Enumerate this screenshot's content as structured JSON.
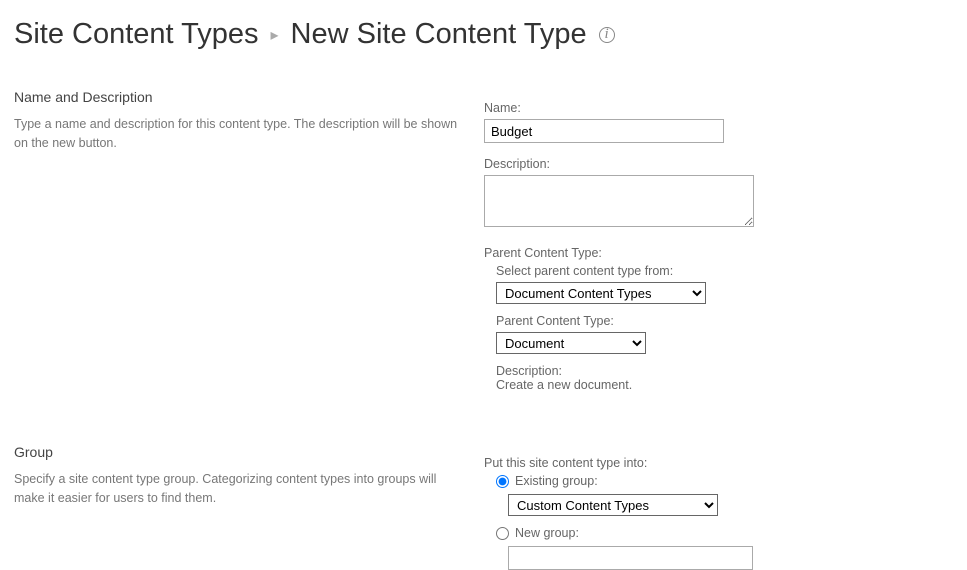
{
  "header": {
    "breadcrumb_link": "Site Content Types",
    "title": "New Site Content Type",
    "info_glyph": "i"
  },
  "section_name": {
    "heading": "Name and Description",
    "helptext": "Type a name and description for this content type. The description will be shown on the new button.",
    "name_label": "Name:",
    "name_value": "Budget",
    "description_label": "Description:",
    "description_value": "",
    "parent_label": "Parent Content Type:",
    "parent_group_label": "Select parent content type from:",
    "parent_group_value": "Document Content Types",
    "parent_ct_label": "Parent Content Type:",
    "parent_ct_value": "Document",
    "parent_desc_label": "Description:",
    "parent_desc_value": "Create a new document."
  },
  "section_group": {
    "heading": "Group",
    "helptext": "Specify a site content type group. Categorizing content types into groups will make it easier for users to find them.",
    "put_label": "Put this site content type into:",
    "existing_label": "Existing group:",
    "existing_value": "Custom Content Types",
    "newgroup_label": "New group:",
    "newgroup_value": ""
  }
}
